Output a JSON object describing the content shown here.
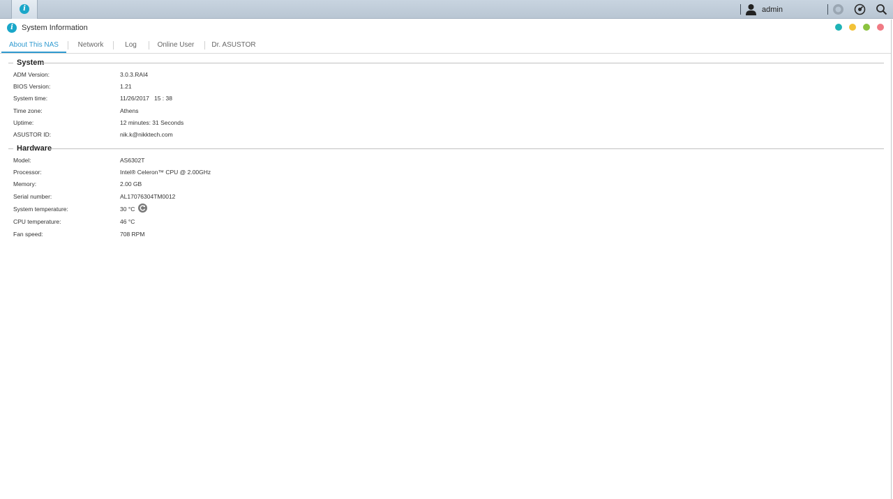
{
  "taskbar": {
    "app_icon": "info-icon",
    "user_icon": "user-icon",
    "username": "admin",
    "icons": [
      "notification-icon",
      "settings-dial-icon",
      "search-icon"
    ]
  },
  "window": {
    "icon": "info-icon",
    "title": "System Information",
    "controls": [
      {
        "name": "restore",
        "color": "#1fb3b6"
      },
      {
        "name": "minimize",
        "color": "#f2c237"
      },
      {
        "name": "maximize",
        "color": "#8bc33f"
      },
      {
        "name": "close",
        "color": "#f07a84"
      }
    ]
  },
  "tabs": [
    {
      "label": "About This NAS",
      "active": true
    },
    {
      "label": "Network",
      "active": false
    },
    {
      "label": "Log",
      "active": false
    },
    {
      "label": "Online User",
      "active": false
    },
    {
      "label": "Dr. ASUSTOR",
      "active": false
    }
  ],
  "system": {
    "title": "System",
    "rows": [
      {
        "label": "ADM Version:",
        "value": "3.0.3.RAI4"
      },
      {
        "label": "BIOS Version:",
        "value": "1.21"
      },
      {
        "label": "System time:",
        "value": "11/26/2017   15 : 38"
      },
      {
        "label": "Time zone:",
        "value": "Athens"
      },
      {
        "label": "Uptime:",
        "value": "12 minutes: 31 Seconds"
      },
      {
        "label": "ASUSTOR ID:",
        "value": "nik.k@nikktech.com"
      }
    ]
  },
  "hardware": {
    "title": "Hardware",
    "rows": [
      {
        "label": "Model:",
        "value": "AS6302T"
      },
      {
        "label": "Processor:",
        "value": "Intel® Celeron™ CPU @ 2.00GHz"
      },
      {
        "label": "Memory:",
        "value": "2.00 GB"
      },
      {
        "label": "Serial number:",
        "value": "AL17076304TM0012"
      },
      {
        "label": "System temperature:",
        "value": "30 °C"
      },
      {
        "label": "CPU temperature:",
        "value": "46 °C"
      },
      {
        "label": "Fan speed:",
        "value": "708 RPM"
      }
    ]
  },
  "colors": {
    "accent": "#2f9ad0",
    "info_icon": "#1aa7c9"
  }
}
